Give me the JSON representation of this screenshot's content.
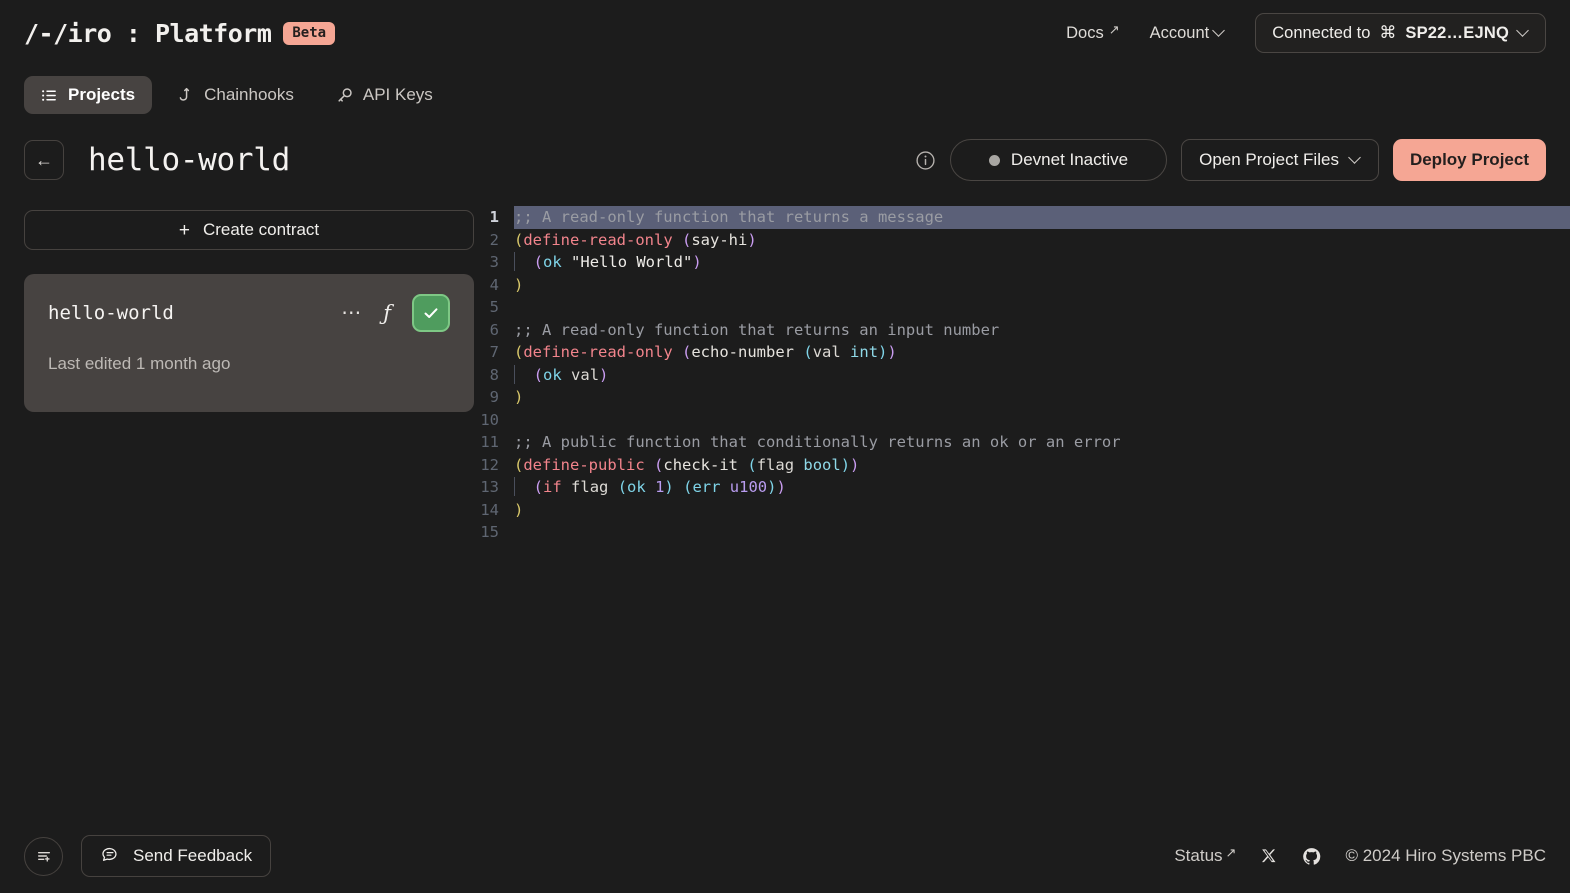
{
  "header": {
    "brand": "/-/iro : Platform",
    "badge": "Beta",
    "docs_label": "Docs",
    "docs_icon": "arrow-up-right-icon",
    "account_label": "Account",
    "account_chevron": "chevron-down-icon",
    "connected_prefix": "Connected to",
    "connected_glyph": "⌘",
    "connected_id": "SP22…EJNQ",
    "connected_chevron": "chevron-down-icon"
  },
  "tabs": [
    {
      "label": "Projects",
      "icon": "list-icon",
      "active": true
    },
    {
      "label": "Chainhooks",
      "icon": "hook-icon",
      "active": false
    },
    {
      "label": "API Keys",
      "icon": "key-icon",
      "active": false
    }
  ],
  "project": {
    "back_icon": "arrow-left-icon",
    "title": "hello-world",
    "info_icon": "info-circle-icon",
    "devnet_status": "Devnet Inactive",
    "devnet_dot_color": "#a8a6a2",
    "open_files_label": "Open Project Files",
    "deploy_label": "Deploy Project",
    "deploy_color": "#f5a694"
  },
  "sidebar": {
    "create_label": "Create contract",
    "create_icon": "plus-icon",
    "contract": {
      "name": "hello-world",
      "more_icon": "ellipsis-icon",
      "function_icon": "function-icon",
      "checked": true,
      "check_icon": "check-icon",
      "check_color": "#4f9c5e",
      "last_edited": "Last edited 1 month ago"
    }
  },
  "editor": {
    "highlighted_line": 1,
    "lines": [
      {
        "n": 1,
        "tokens": [
          {
            "t": ";; A read-only function that returns a message",
            "c": "tok-comment"
          }
        ]
      },
      {
        "n": 2,
        "tokens": [
          {
            "t": "(",
            "c": "par1"
          },
          {
            "t": "define-read-only",
            "c": "tok-kw"
          },
          {
            "t": " ",
            "c": "tok-plain"
          },
          {
            "t": "(",
            "c": "par2"
          },
          {
            "t": "say-hi",
            "c": "tok-fn"
          },
          {
            "t": ")",
            "c": "par2"
          }
        ]
      },
      {
        "n": 3,
        "indent": true,
        "tokens": [
          {
            "t": "  ",
            "c": "tok-plain"
          },
          {
            "t": "(",
            "c": "par2"
          },
          {
            "t": "ok",
            "c": "tok-builtin"
          },
          {
            "t": " ",
            "c": "tok-plain"
          },
          {
            "t": "\"Hello World\"",
            "c": "tok-str"
          },
          {
            "t": ")",
            "c": "par2"
          }
        ]
      },
      {
        "n": 4,
        "tokens": [
          {
            "t": ")",
            "c": "par1"
          }
        ]
      },
      {
        "n": 5,
        "tokens": []
      },
      {
        "n": 6,
        "tokens": [
          {
            "t": ";; A read-only function that returns an input number",
            "c": "tok-comment"
          }
        ]
      },
      {
        "n": 7,
        "tokens": [
          {
            "t": "(",
            "c": "par1"
          },
          {
            "t": "define-read-only",
            "c": "tok-kw"
          },
          {
            "t": " ",
            "c": "tok-plain"
          },
          {
            "t": "(",
            "c": "par2"
          },
          {
            "t": "echo-number",
            "c": "tok-fn"
          },
          {
            "t": " ",
            "c": "tok-plain"
          },
          {
            "t": "(",
            "c": "par3"
          },
          {
            "t": "val",
            "c": "tok-plain"
          },
          {
            "t": " ",
            "c": "tok-plain"
          },
          {
            "t": "int",
            "c": "tok-type"
          },
          {
            "t": ")",
            "c": "par3"
          },
          {
            "t": ")",
            "c": "par2"
          }
        ]
      },
      {
        "n": 8,
        "indent": true,
        "tokens": [
          {
            "t": "  ",
            "c": "tok-plain"
          },
          {
            "t": "(",
            "c": "par2"
          },
          {
            "t": "ok",
            "c": "tok-builtin"
          },
          {
            "t": " ",
            "c": "tok-plain"
          },
          {
            "t": "val",
            "c": "tok-plain"
          },
          {
            "t": ")",
            "c": "par2"
          }
        ]
      },
      {
        "n": 9,
        "tokens": [
          {
            "t": ")",
            "c": "par1"
          }
        ]
      },
      {
        "n": 10,
        "tokens": []
      },
      {
        "n": 11,
        "tokens": [
          {
            "t": ";; A public function that conditionally returns an ok or an error",
            "c": "tok-comment"
          }
        ]
      },
      {
        "n": 12,
        "tokens": [
          {
            "t": "(",
            "c": "par1"
          },
          {
            "t": "define-public",
            "c": "tok-kw"
          },
          {
            "t": " ",
            "c": "tok-plain"
          },
          {
            "t": "(",
            "c": "par2"
          },
          {
            "t": "check-it",
            "c": "tok-fn"
          },
          {
            "t": " ",
            "c": "tok-plain"
          },
          {
            "t": "(",
            "c": "par3"
          },
          {
            "t": "flag",
            "c": "tok-plain"
          },
          {
            "t": " ",
            "c": "tok-plain"
          },
          {
            "t": "bool",
            "c": "tok-type"
          },
          {
            "t": ")",
            "c": "par3"
          },
          {
            "t": ")",
            "c": "par2"
          }
        ]
      },
      {
        "n": 13,
        "indent": true,
        "tokens": [
          {
            "t": "  ",
            "c": "tok-plain"
          },
          {
            "t": "(",
            "c": "par2"
          },
          {
            "t": "if",
            "c": "tok-kw"
          },
          {
            "t": " ",
            "c": "tok-plain"
          },
          {
            "t": "flag",
            "c": "tok-plain"
          },
          {
            "t": " ",
            "c": "tok-plain"
          },
          {
            "t": "(",
            "c": "par3"
          },
          {
            "t": "ok",
            "c": "tok-builtin"
          },
          {
            "t": " ",
            "c": "tok-plain"
          },
          {
            "t": "1",
            "c": "tok-num"
          },
          {
            "t": ")",
            "c": "par3"
          },
          {
            "t": " ",
            "c": "tok-plain"
          },
          {
            "t": "(",
            "c": "par3"
          },
          {
            "t": "err",
            "c": "tok-builtin"
          },
          {
            "t": " ",
            "c": "tok-plain"
          },
          {
            "t": "u100",
            "c": "tok-num"
          },
          {
            "t": ")",
            "c": "par3"
          },
          {
            "t": ")",
            "c": "par2"
          }
        ]
      },
      {
        "n": 14,
        "tokens": [
          {
            "t": ")",
            "c": "par1"
          }
        ]
      },
      {
        "n": 15,
        "tokens": []
      }
    ]
  },
  "footer": {
    "menu_icon": "list-plus-icon",
    "feedback_label": "Send Feedback",
    "feedback_icon": "message-icon",
    "status_label": "Status",
    "status_icon": "arrow-up-right-icon",
    "x_icon": "x-twitter-icon",
    "github_icon": "github-icon",
    "copyright": "© 2024 Hiro Systems PBC"
  }
}
